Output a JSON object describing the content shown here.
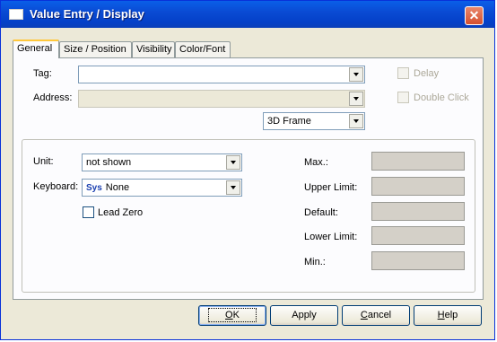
{
  "window": {
    "title": "Value Entry / Display",
    "close_glyph": "✕"
  },
  "tabs": [
    {
      "label": "General",
      "active": true
    },
    {
      "label": "Size / Position",
      "active": false
    },
    {
      "label": "Visibility",
      "active": false
    },
    {
      "label": "Color/Font",
      "active": false
    }
  ],
  "general": {
    "tag_label": "Tag:",
    "tag_value": "",
    "address_label": "Address:",
    "address_value": "",
    "frame_value": "3D Frame",
    "delay_label": "Delay",
    "double_click_label": "Double Click"
  },
  "group": {
    "unit_label": "Unit:",
    "unit_value": "not shown",
    "keyboard_label": "Keyboard:",
    "keyboard_prefix": "Sys",
    "keyboard_value": "None",
    "lead_zero_label": "Lead Zero",
    "max_label": "Max.:",
    "upper_limit_label": "Upper Limit:",
    "default_label": "Default:",
    "lower_limit_label": "Lower Limit:",
    "min_label": "Min.:"
  },
  "buttons": {
    "ok_label_u": "O",
    "ok_label_rest": "K",
    "apply_label": "Apply",
    "cancel_label_u": "C",
    "cancel_label_rest": "ancel",
    "help_label_u": "H",
    "help_label_rest": "elp"
  }
}
